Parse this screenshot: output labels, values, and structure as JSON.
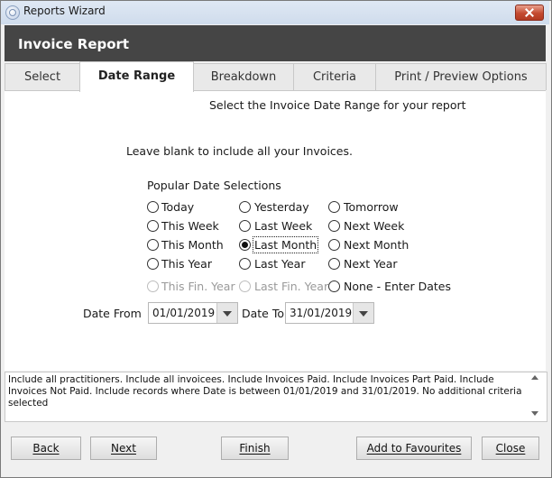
{
  "window": {
    "title": "Reports Wizard",
    "icon": "app-icon",
    "close_icon": "close-icon"
  },
  "header": {
    "title": "Invoice Report"
  },
  "tabs": [
    {
      "label": "Select",
      "active": false
    },
    {
      "label": "Date Range",
      "active": true
    },
    {
      "label": "Breakdown",
      "active": false
    },
    {
      "label": "Criteria",
      "active": false
    },
    {
      "label": "Print / Preview Options",
      "active": false
    }
  ],
  "panel": {
    "heading": "Select the Invoice Date Range for your report",
    "hint": "Leave blank to include all your Invoices.",
    "popular_label": "Popular Date Selections",
    "options": [
      {
        "label": "Today",
        "checked": false,
        "enabled": true
      },
      {
        "label": "Yesterday",
        "checked": false,
        "enabled": true
      },
      {
        "label": "Tomorrow",
        "checked": false,
        "enabled": true
      },
      {
        "label": "This Week",
        "checked": false,
        "enabled": true
      },
      {
        "label": "Last Week",
        "checked": false,
        "enabled": true
      },
      {
        "label": "Next Week",
        "checked": false,
        "enabled": true
      },
      {
        "label": "This Month",
        "checked": false,
        "enabled": true
      },
      {
        "label": "Last Month",
        "checked": true,
        "enabled": true
      },
      {
        "label": "Next Month",
        "checked": false,
        "enabled": true
      },
      {
        "label": "This Year",
        "checked": false,
        "enabled": true
      },
      {
        "label": "Last Year",
        "checked": false,
        "enabled": true
      },
      {
        "label": "Next Year",
        "checked": false,
        "enabled": true
      },
      {
        "label": "This Fin. Year",
        "checked": false,
        "enabled": false
      },
      {
        "label": "Last Fin. Year",
        "checked": false,
        "enabled": false
      },
      {
        "label": "None - Enter Dates",
        "checked": false,
        "enabled": true
      }
    ],
    "date_from_label": "Date From",
    "date_from_value": "01/01/2019",
    "date_to_label": "Date To",
    "date_to_value": "31/01/2019"
  },
  "summary": {
    "text": "Include all practitioners. Include all invoicees. Include Invoices Paid. Include Invoices Part Paid. Include Invoices Not Paid. Include records where Date is between 01/01/2019 and 31/01/2019. No additional criteria selected"
  },
  "buttons": {
    "back": "Back",
    "next": "Next",
    "finish": "Finish",
    "add_favourites": "Add to Favourites",
    "close": "Close"
  }
}
